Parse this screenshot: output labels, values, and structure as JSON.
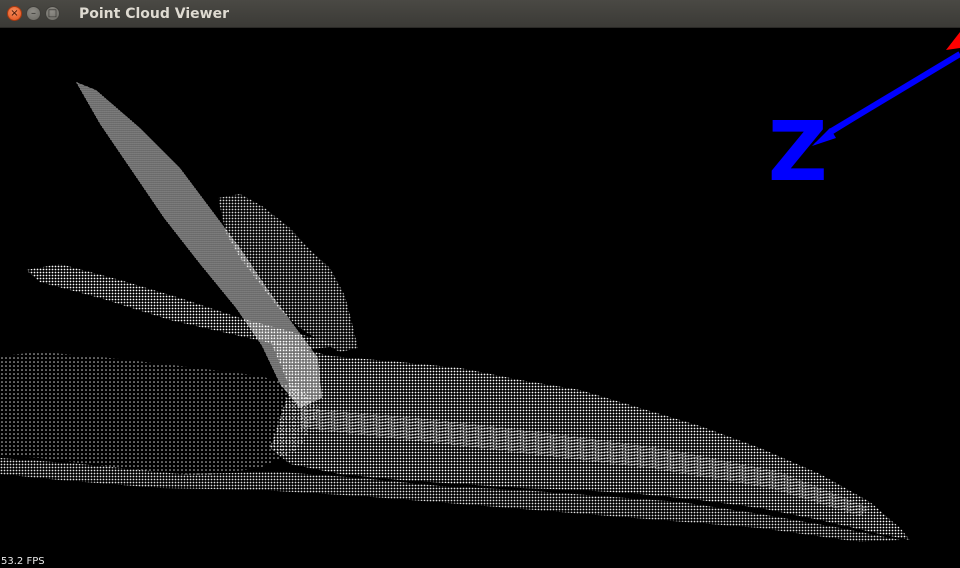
{
  "window": {
    "title": "Point Cloud Viewer",
    "close_glyph": "×",
    "minimize_glyph": "–",
    "maximize_glyph": "□"
  },
  "viewport": {
    "background_color": "#000000",
    "point_color": "#ffffff",
    "axis_label": "Z",
    "axis_color": "#0000ff",
    "secondary_axis_color": "#ff0000"
  },
  "status": {
    "fps_text": "53.2 FPS"
  }
}
